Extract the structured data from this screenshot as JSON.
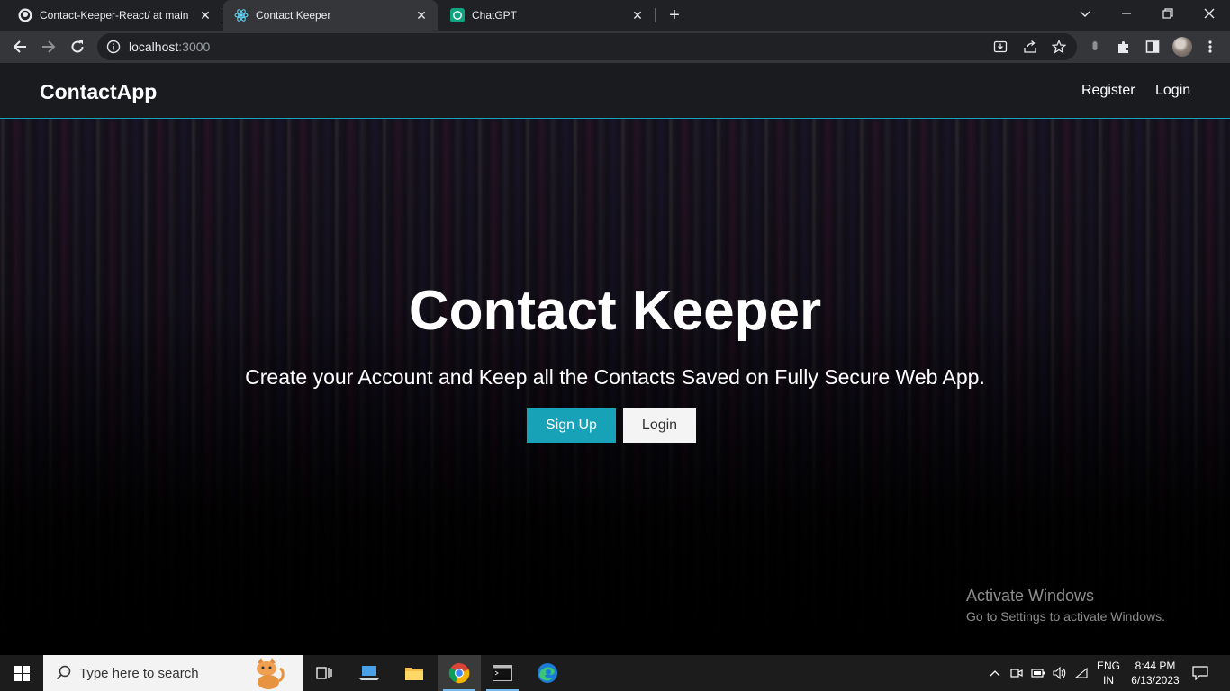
{
  "browser": {
    "tabs": [
      {
        "title": "Contact-Keeper-React/ at main · "
      },
      {
        "title": "Contact Keeper"
      },
      {
        "title": "ChatGPT"
      }
    ],
    "url_host": "localhost",
    "url_port": ":3000"
  },
  "app": {
    "brand": "ContactApp",
    "nav": {
      "register": "Register",
      "login": "Login"
    },
    "hero": {
      "title": "Contact Keeper",
      "subtitle": "Create your Account and Keep all the Contacts Saved on Fully Secure Web App.",
      "signup_label": "Sign Up",
      "login_label": "Login"
    },
    "accent_color": "#17a2b8"
  },
  "watermark": {
    "line1": "Activate Windows",
    "line2": "Go to Settings to activate Windows."
  },
  "taskbar": {
    "search_placeholder": "Type here to search",
    "lang_top": "ENG",
    "lang_bottom": "IN",
    "time": "8:44 PM",
    "date": "6/13/2023"
  }
}
